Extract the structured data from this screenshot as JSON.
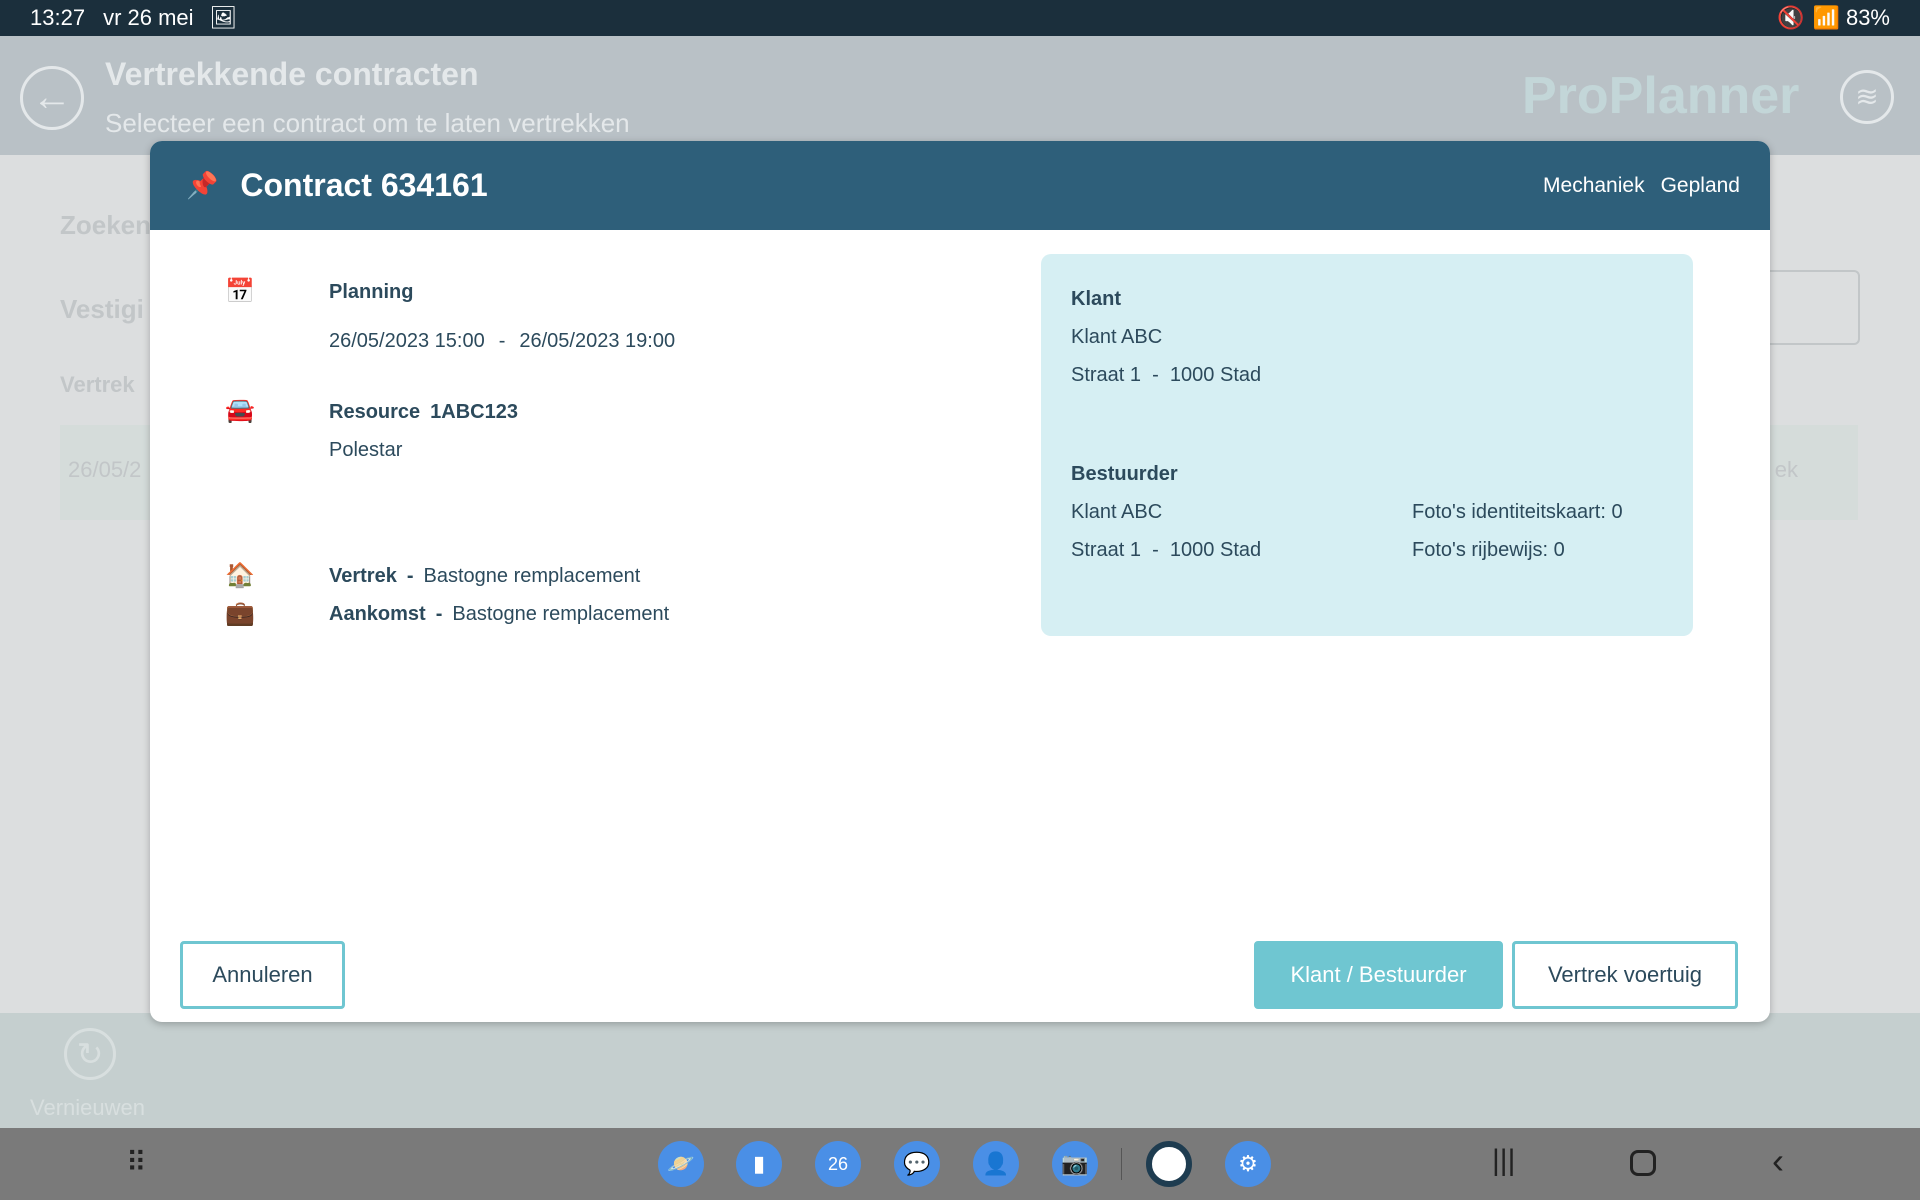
{
  "status_bar": {
    "time": "13:27",
    "date": "vr 26 mei",
    "battery": "83%",
    "icons": [
      "image-icon",
      "mute-icon",
      "wifi-icon",
      "battery-icon"
    ]
  },
  "background": {
    "title": "Vertrekkende contracten",
    "subtitle": "Selecteer een contract om te laten vertrekken",
    "brand": "ProPlanner",
    "search_label": "Zoeken",
    "branch_label": "Vestigi",
    "departure_label": "Vertrek",
    "row_date": "26/05/2",
    "row_tail": "ek",
    "refresh_label": "Vernieuwen"
  },
  "modal": {
    "title": "Contract 634161",
    "tags": [
      "Mechaniek",
      "Gepland"
    ],
    "planning": {
      "label": "Planning",
      "start": "26/05/2023 15:00",
      "sep": "-",
      "end": "26/05/2023 19:00"
    },
    "resource": {
      "label": "Resource",
      "plate": "1ABC123",
      "model": "Polestar"
    },
    "departure": {
      "label": "Vertrek",
      "sep": "-",
      "location": "Bastogne remplacement"
    },
    "arrival": {
      "label": "Aankomst",
      "sep": "-",
      "location": "Bastogne remplacement"
    },
    "customer": {
      "label": "Klant",
      "name": "Klant ABC",
      "address": "Straat 1  -  1000 Stad"
    },
    "driver": {
      "label": "Bestuurder",
      "name": "Klant ABC",
      "address": "Straat 1  -  1000 Stad",
      "id_photos": "Foto's identiteitskaart: 0",
      "license_photos": "Foto's rijbewijs: 0"
    },
    "buttons": {
      "cancel": "Annuleren",
      "customer_driver": "Klant / Bestuurder",
      "depart": "Vertrek voertuig"
    }
  },
  "colors": {
    "header": "#2e5f7a",
    "accent": "#6fc6d1",
    "card": "#d6eff3"
  }
}
